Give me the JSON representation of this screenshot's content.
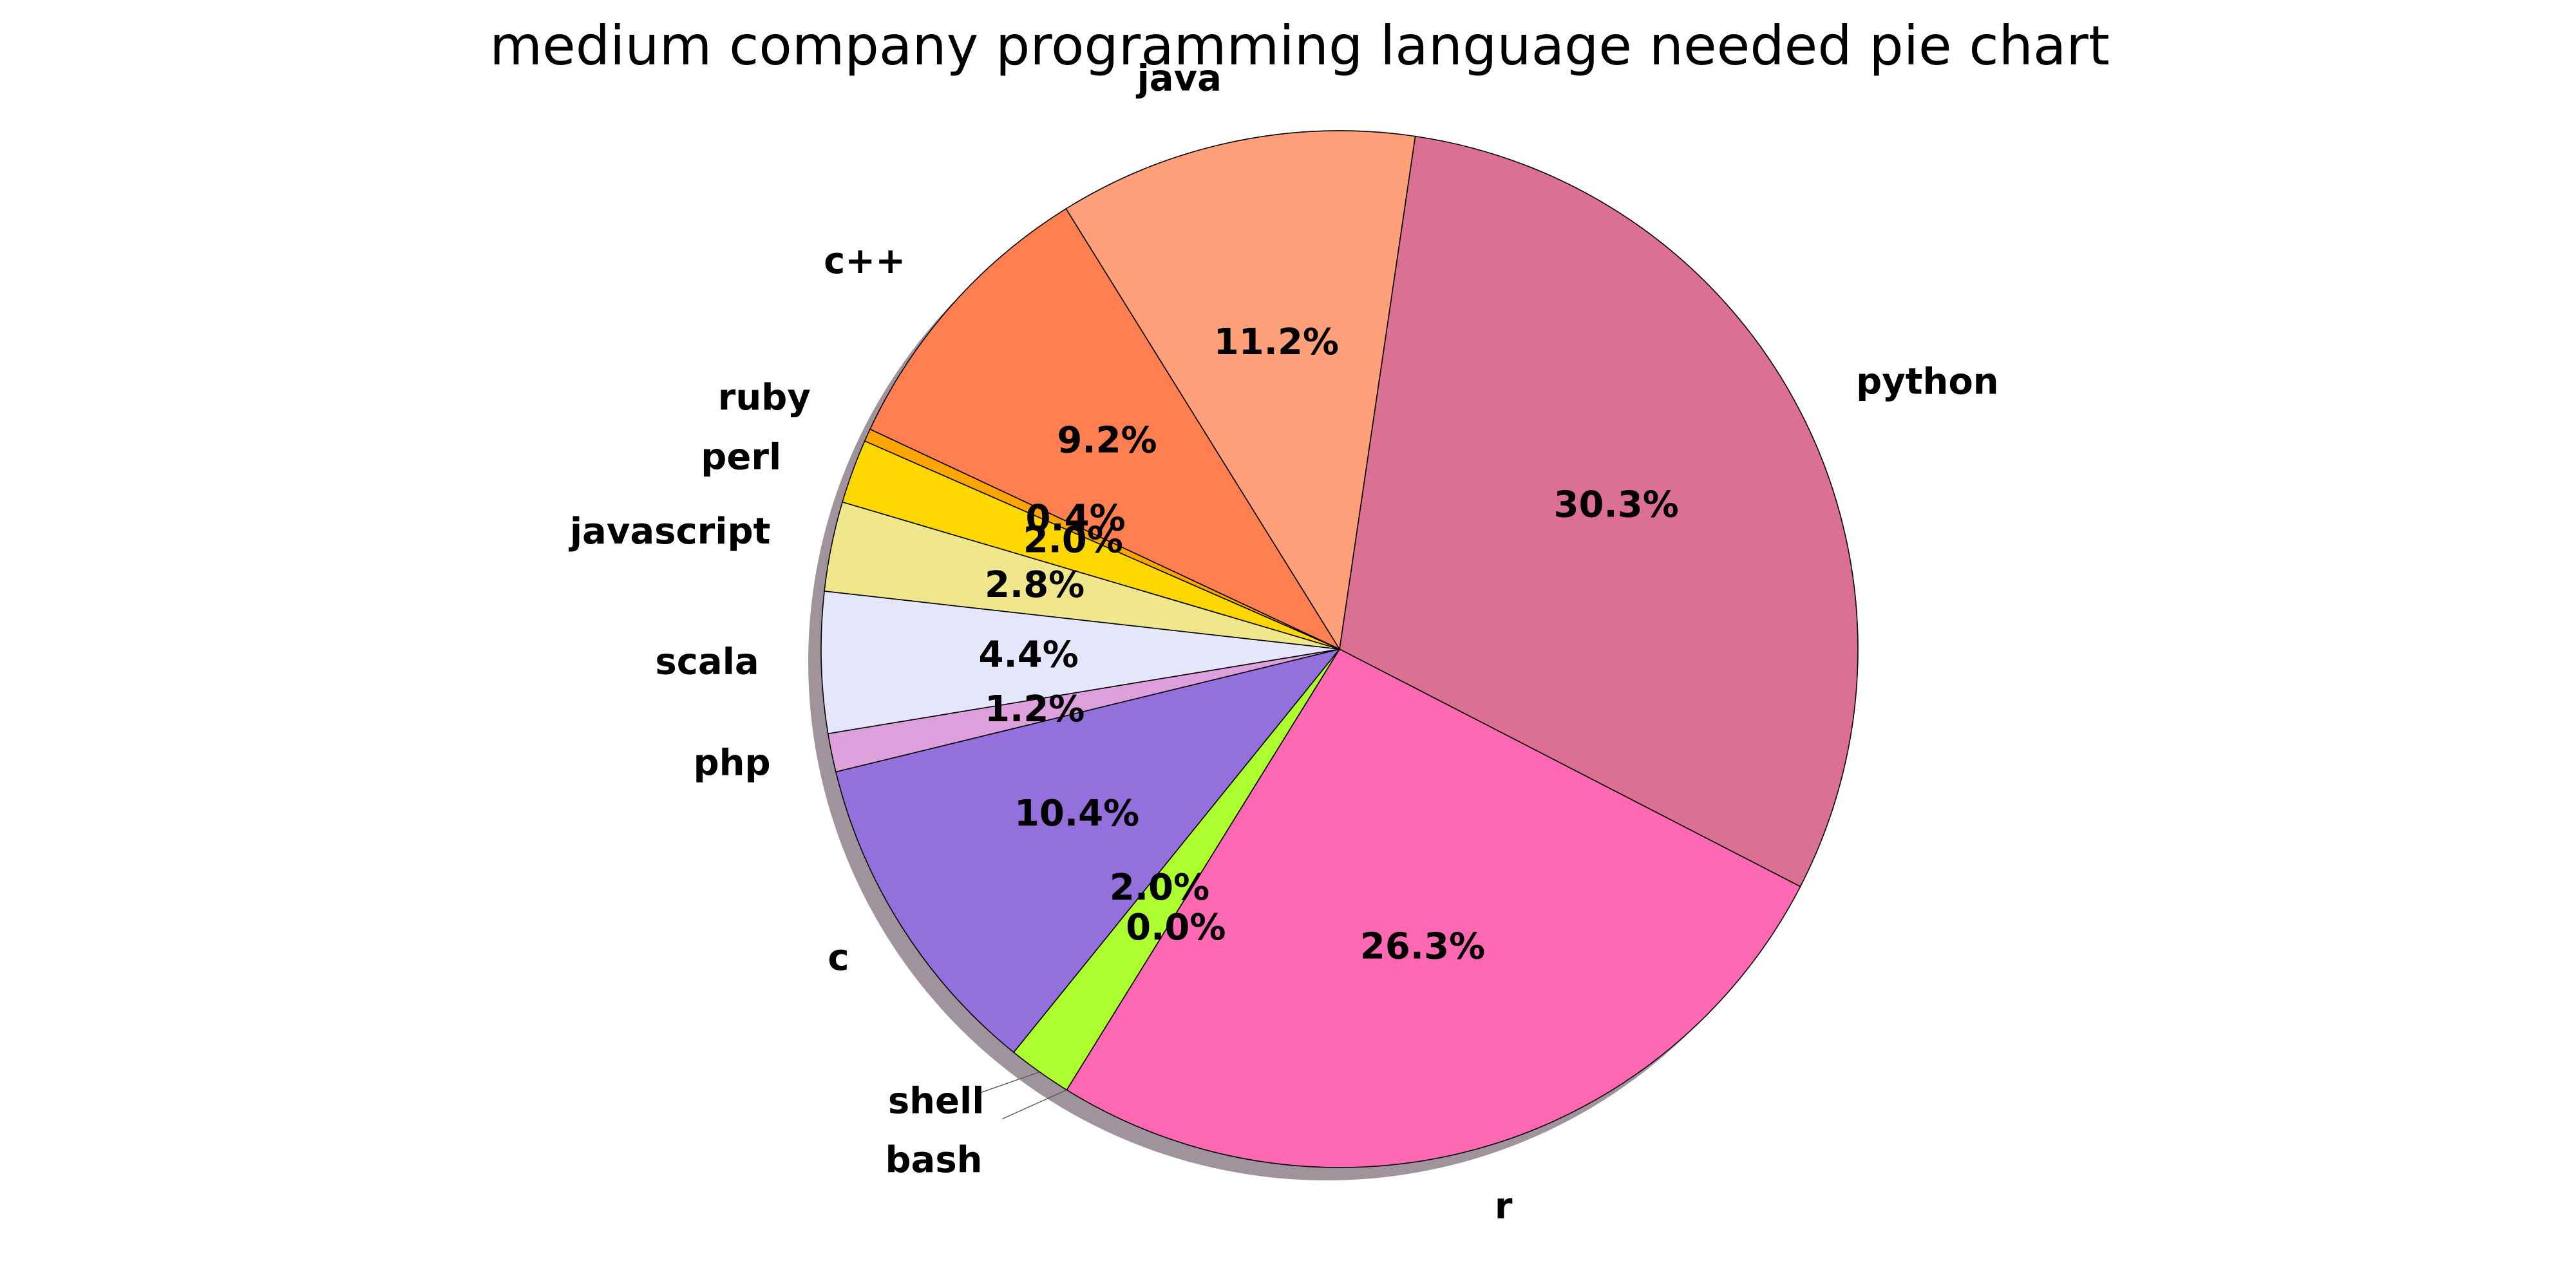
{
  "chart_data": {
    "type": "pie",
    "title": "medium company programming language needed pie chart",
    "slices": [
      {
        "label": "python",
        "value": 30.3,
        "pct_label": "30.3%",
        "color": "#db7093"
      },
      {
        "label": "r",
        "value": 26.3,
        "pct_label": "26.3%",
        "color": "#ff69b4"
      },
      {
        "label": "bash",
        "value": 0.0,
        "pct_label": "0.0%",
        "color": "#7cfc00"
      },
      {
        "label": "shell",
        "value": 2.0,
        "pct_label": "2.0%",
        "color": "#adff2f"
      },
      {
        "label": "c",
        "value": 10.4,
        "pct_label": "10.4%",
        "color": "#9370db"
      },
      {
        "label": "php",
        "value": 1.2,
        "pct_label": "1.2%",
        "color": "#dda0dd"
      },
      {
        "label": "scala",
        "value": 4.4,
        "pct_label": "4.4%",
        "color": "#e6e6fa"
      },
      {
        "label": "javascript",
        "value": 2.8,
        "pct_label": "2.8%",
        "color": "#f0e68c"
      },
      {
        "label": "perl",
        "value": 2.0,
        "pct_label": "2.0%",
        "color": "#ffd700"
      },
      {
        "label": "ruby",
        "value": 0.4,
        "pct_label": "0.4%",
        "color": "#ffa500"
      },
      {
        "label": "c++",
        "value": 9.2,
        "pct_label": "9.2%",
        "color": "#ff7f50"
      },
      {
        "label": "java",
        "value": 11.2,
        "pct_label": "11.2%",
        "color": "#ffa07a"
      }
    ],
    "start_angle_deg": -81.6,
    "direction": "clockwise",
    "shadow": true,
    "legend": "none"
  }
}
